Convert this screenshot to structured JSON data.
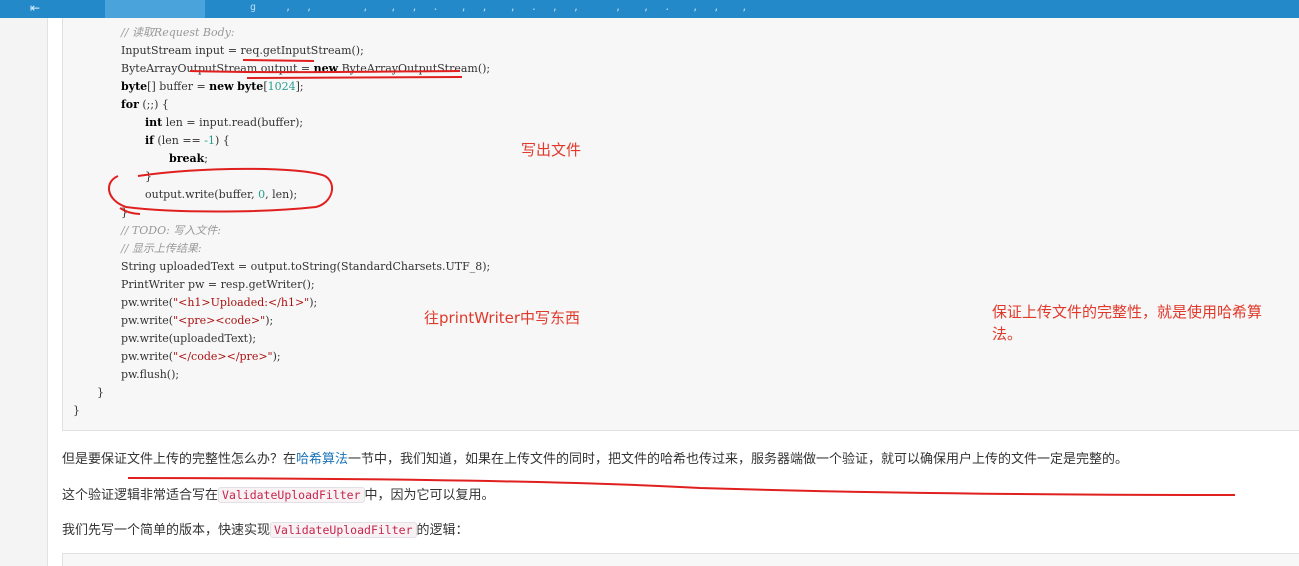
{
  "topbar": {
    "back_glyph": "⇤",
    "text_fragment": "g    ,  ,       ,   ,  ,  .   ,  ,   ,  .  ,  ,     ,   ,  .   ,  ,   ,  "
  },
  "code": {
    "lines": [
      {
        "parts": [
          {
            "t": "// 读取Request Body:",
            "c": "cmt"
          }
        ]
      },
      {
        "parts": [
          {
            "t": "InputStream input = req.getInputStream();"
          }
        ]
      },
      {
        "parts": [
          {
            "t": "ByteArrayOutputStream output = "
          },
          {
            "t": "new",
            "c": "kw"
          },
          {
            "t": " ByteArrayOutputStream();"
          }
        ]
      },
      {
        "parts": [
          {
            "t": "byte",
            "c": "kw"
          },
          {
            "t": "[] buffer = "
          },
          {
            "t": "new",
            "c": "kw"
          },
          {
            "t": " "
          },
          {
            "t": "byte",
            "c": "kw"
          },
          {
            "t": "["
          },
          {
            "t": "1024",
            "c": "num"
          },
          {
            "t": "];"
          }
        ]
      },
      {
        "parts": [
          {
            "t": "for",
            "c": "kw"
          },
          {
            "t": " (;;) {"
          }
        ]
      },
      {
        "parts": [
          {
            "t": "int",
            "c": "kw"
          },
          {
            "t": " len = input.read(buffer);"
          }
        ]
      },
      {
        "parts": [
          {
            "t": "if",
            "c": "kw"
          },
          {
            "t": " (len == "
          },
          {
            "t": "-1",
            "c": "num"
          },
          {
            "t": ") {"
          }
        ]
      },
      {
        "parts": [
          {
            "t": "break",
            "c": "kw"
          },
          {
            "t": ";"
          }
        ]
      },
      {
        "parts": [
          {
            "t": "}"
          }
        ]
      },
      {
        "parts": [
          {
            "t": "output.write(buffer, "
          },
          {
            "t": "0",
            "c": "num"
          },
          {
            "t": ", len);"
          }
        ]
      },
      {
        "parts": [
          {
            "t": "}"
          }
        ]
      },
      {
        "parts": [
          {
            "t": "// TODO: 写入文件:",
            "c": "cmt"
          }
        ]
      },
      {
        "parts": [
          {
            "t": "// 显示上传结果:",
            "c": "cmt"
          }
        ]
      },
      {
        "parts": [
          {
            "t": "String uploadedText = output.toString(StandardCharsets.UTF_8);"
          }
        ]
      },
      {
        "parts": [
          {
            "t": "PrintWriter pw = resp.getWriter();"
          }
        ]
      },
      {
        "parts": [
          {
            "t": "pw.write("
          },
          {
            "t": "\"<h1>Uploaded:</h1>\"",
            "c": "str"
          },
          {
            "t": ");"
          }
        ]
      },
      {
        "parts": [
          {
            "t": "pw.write("
          },
          {
            "t": "\"<pre><code>\"",
            "c": "str"
          },
          {
            "t": ");"
          }
        ]
      },
      {
        "parts": [
          {
            "t": "pw.write(uploadedText);"
          }
        ]
      },
      {
        "parts": [
          {
            "t": "pw.write("
          },
          {
            "t": "\"</code></pre>\"",
            "c": "str"
          },
          {
            "t": ");"
          }
        ]
      },
      {
        "parts": [
          {
            "t": "pw.flush();"
          }
        ]
      },
      {
        "parts": [
          {
            "t": "}"
          }
        ]
      },
      {
        "parts": [
          {
            "t": "}"
          }
        ]
      }
    ]
  },
  "annotations": {
    "write_file": "写出文件",
    "print_writer": "往printWriter中写东西",
    "integrity_line1": "保证上传文件的完整性，就是使用哈希算",
    "integrity_line2": "法。"
  },
  "prose": {
    "p1_before": "但是要保证文件上传的完整性怎么办？在",
    "p1_link": "哈希算法",
    "p1_after": "一节中，我们知道，如果在上传文件的同时，把文件的哈希也传过来，服务器端做一个验证，就可以确保用户上传的文件一定是完整的。",
    "p2_before": "这个验证逻辑非常适合写在",
    "p2_code": "ValidateUploadFilter",
    "p2_after": "中，因为它可以复用。",
    "p3_before": "我们先写一个简单的版本，快速实现",
    "p3_code": "ValidateUploadFilter",
    "p3_after": "的逻辑："
  }
}
